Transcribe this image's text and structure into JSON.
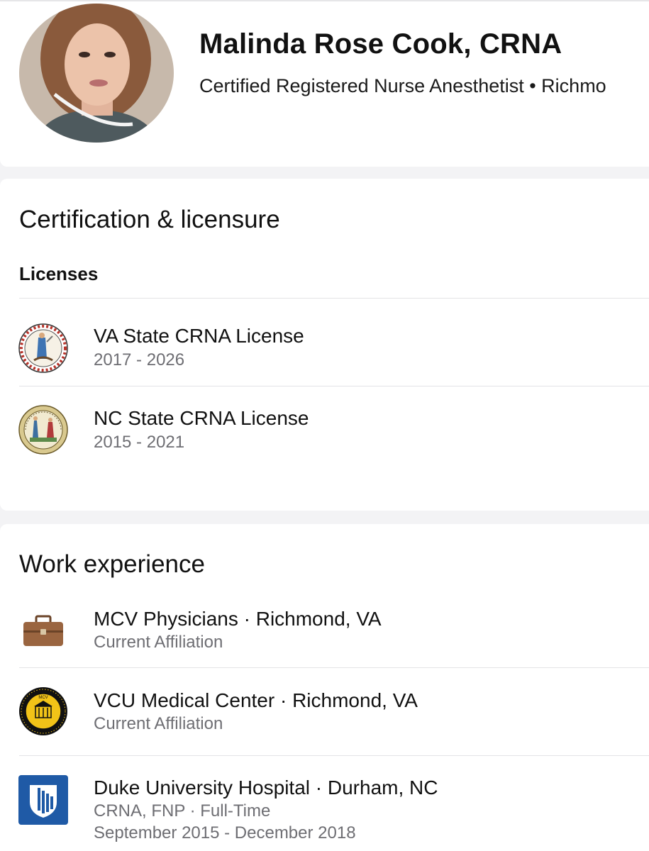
{
  "profile": {
    "name": "Malinda Rose Cook, CRNA",
    "subtitle": "Certified Registered Nurse Anesthetist • Richmo",
    "avatar_icon": "profile-photo"
  },
  "certification": {
    "title": "Certification & licensure",
    "licenses_heading": "Licenses",
    "licenses": [
      {
        "name": "VA State CRNA License",
        "dates": "2017 - 2026",
        "icon": "virginia-state-seal-icon"
      },
      {
        "name": "NC State CRNA License",
        "dates": "2015 - 2021",
        "icon": "north-carolina-state-seal-icon"
      }
    ]
  },
  "work": {
    "title": "Work experience",
    "items": [
      {
        "title": "MCV Physicians · Richmond, VA",
        "detail": "Current Affiliation",
        "icon": "briefcase-icon"
      },
      {
        "title": "VCU Medical Center · Richmond, VA",
        "detail": "Current Affiliation",
        "icon": "vcu-seal-icon",
        "seal_text": "MCV",
        "seal_year": "1838"
      },
      {
        "title": "Duke University Hospital · Durham, NC",
        "detail": "CRNA, FNP · Full-Time",
        "dates": "September 2015 - December 2018",
        "icon": "duke-shield-icon"
      }
    ]
  },
  "colors": {
    "background": "#f3f3f5",
    "card": "#ffffff",
    "secondary_text": "#6e6e73",
    "duke_blue": "#1f5aa6"
  }
}
